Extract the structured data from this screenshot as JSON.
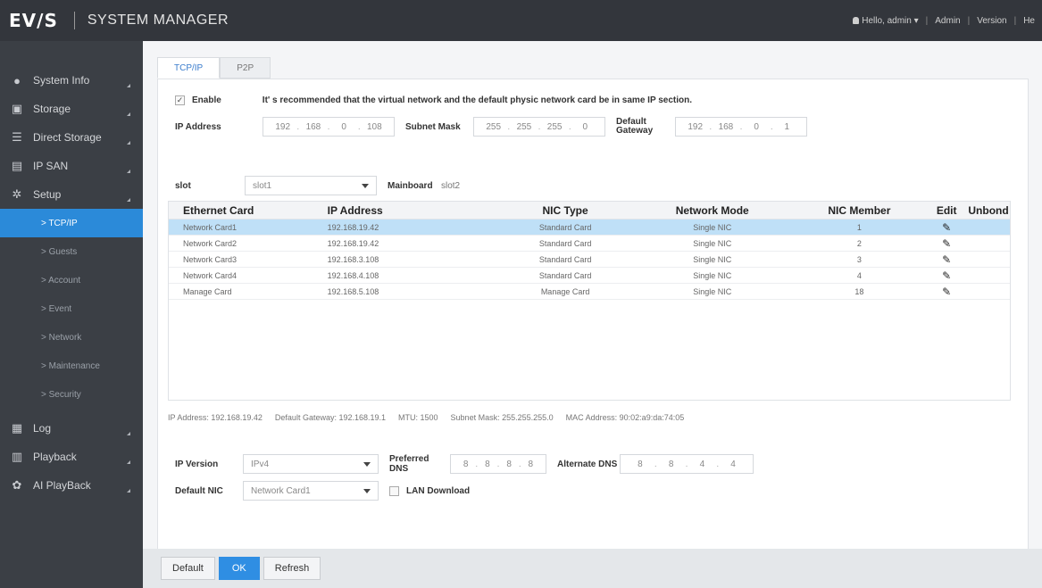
{
  "header": {
    "logo": "EV/S",
    "title": "SYSTEM MANAGER",
    "user": "Hello, admin",
    "links": [
      "Admin",
      "Version",
      "He"
    ]
  },
  "sidebar": {
    "items": [
      {
        "label": "System Info",
        "icon": "info-icon"
      },
      {
        "label": "Storage",
        "icon": "storage-icon"
      },
      {
        "label": "Direct Storage",
        "icon": "direct-storage-icon"
      },
      {
        "label": "IP SAN",
        "icon": "ipsan-icon"
      },
      {
        "label": "Setup",
        "icon": "gear-icon"
      }
    ],
    "setup_sub": [
      "> TCP/IP",
      "> Guests",
      "> Account",
      "> Event",
      "> Network",
      "> Maintenance",
      "> Security"
    ],
    "bottom_items": [
      {
        "label": "Log",
        "icon": "log-icon"
      },
      {
        "label": "Playback",
        "icon": "playback-icon"
      },
      {
        "label": "AI PlayBack",
        "icon": "ai-playback-icon"
      }
    ]
  },
  "tabs": [
    "TCP/IP",
    "P2P"
  ],
  "form": {
    "enable_label": "Enable",
    "enable_checked": "✓",
    "notice": "It' s recommended that the virtual network and the default physic network card be in same IP section.",
    "ip_label": "IP Address",
    "ip": [
      "192",
      "168",
      "0",
      "108"
    ],
    "mask_label": "Subnet Mask",
    "mask": [
      "255",
      "255",
      "255",
      "0"
    ],
    "gateway_label": "Default Gateway",
    "gateway": [
      "192",
      "168",
      "0",
      "1"
    ],
    "slot_label": "slot",
    "slot_value": "slot1",
    "mainboard_label": "Mainboard",
    "mainboard_value": "slot2"
  },
  "table": {
    "headers": [
      "Ethernet Card",
      "IP Address",
      "NIC Type",
      "Network Mode",
      "NIC Member",
      "Edit",
      "Unbond"
    ],
    "rows": [
      {
        "card": "Network Card1",
        "ip": "192.168.19.42",
        "type": "Standard Card",
        "mode": "Single NIC",
        "member": "1"
      },
      {
        "card": "Network Card2",
        "ip": "192.168.19.42",
        "type": "Standard Card",
        "mode": "Single NIC",
        "member": "2"
      },
      {
        "card": "Network Card3",
        "ip": "192.168.3.108",
        "type": "Standard Card",
        "mode": "Single NIC",
        "member": "3"
      },
      {
        "card": "Network Card4",
        "ip": "192.168.4.108",
        "type": "Standard Card",
        "mode": "Single NIC",
        "member": "4"
      },
      {
        "card": "Manage Card",
        "ip": "192.168.5.108",
        "type": "Manage Card",
        "mode": "Single NIC",
        "member": "18"
      }
    ]
  },
  "info": {
    "ip": "IP Address: 192.168.19.42",
    "gateway": "Default Gateway: 192.168.19.1",
    "mtu": "MTU: 1500",
    "mask": "Subnet Mask: 255.255.255.0",
    "mac": "MAC Address: 90:02:a9:da:74:05"
  },
  "net": {
    "ipver_label": "IP Version",
    "ipver_value": "IPv4",
    "pdns_label": "Preferred DNS",
    "pdns": [
      "8",
      "8",
      "8",
      "8"
    ],
    "adns_label": "Alternate DNS",
    "adns": [
      "8",
      "8",
      "4",
      "4"
    ],
    "nic_label": "Default NIC",
    "nic_value": "Network Card1",
    "lan_label": "LAN Download"
  },
  "buttons": {
    "default": "Default",
    "ok": "OK",
    "refresh": "Refresh"
  },
  "colors": {
    "accent": "#2f8ee3",
    "sidebar": "#3b3f45",
    "selected_row": "#bfe0f7"
  }
}
